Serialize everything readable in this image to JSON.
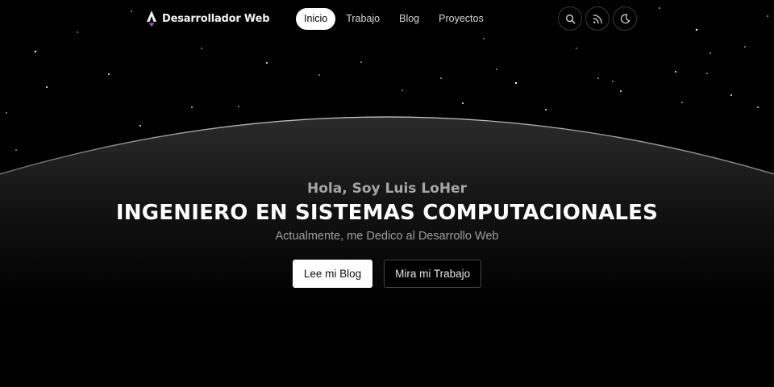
{
  "brand": {
    "name": "Desarrollador Web",
    "logo_icon": "astro-logo-icon",
    "accent": "#b44ee0"
  },
  "nav": {
    "items": [
      {
        "label": "Inicio",
        "active": true
      },
      {
        "label": "Trabajo",
        "active": false
      },
      {
        "label": "Blog",
        "active": false
      },
      {
        "label": "Proyectos",
        "active": false
      }
    ]
  },
  "actions": {
    "icons": [
      "search-icon",
      "rss-icon",
      "moon-icon"
    ]
  },
  "hero": {
    "greeting": "Hola, Soy Luis LoHer",
    "headline": "INGENIERO EN SISTEMAS COMPUTACIONALES",
    "subtitle": "Actualmente, me Dedico al Desarrollo Web",
    "primary_button": "Lee mi Blog",
    "secondary_button": "Mira mi Trabajo"
  },
  "colors": {
    "background": "#000000",
    "text": "#ffffff",
    "muted": "#a6a6a6"
  }
}
